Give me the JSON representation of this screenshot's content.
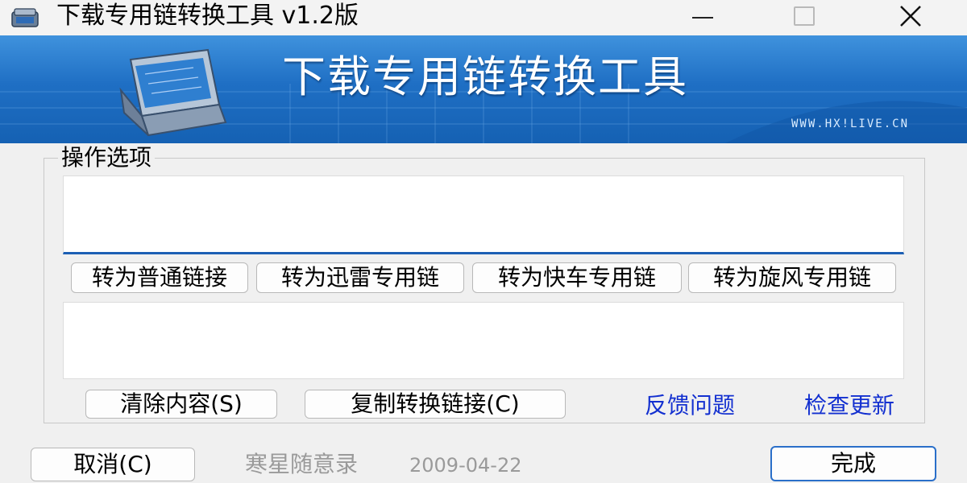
{
  "window": {
    "title": "下载专用链转换工具 v1.2版",
    "app_icon": "suitcase-icon",
    "controls": {
      "minimize_icon": "minimize-icon",
      "maximize_icon": "maximize-icon",
      "close_icon": "close-icon",
      "close_glyph": "✕"
    }
  },
  "banner": {
    "title": "下载专用链转换工具",
    "url": "WWW.HX!LIVE.CN",
    "icon": "suitcase-icon",
    "colors": {
      "top": "#3f92dd",
      "bottom": "#1561b3"
    }
  },
  "options": {
    "legend": "操作选项",
    "input": {
      "value": "",
      "placeholder": ""
    },
    "convert_buttons": [
      {
        "label": "转为普通链接"
      },
      {
        "label": "转为迅雷专用链"
      },
      {
        "label": "转为快车专用链"
      },
      {
        "label": "转为旋风专用链"
      }
    ],
    "output": {
      "value": "",
      "placeholder": ""
    },
    "clear_button": "清除内容(S)",
    "copy_button": "复制转换链接(C)",
    "links": {
      "feedback": "反馈问题",
      "update": "检查更新",
      "color": "#1330d0"
    }
  },
  "footer": {
    "cancel_button": "取消(C)",
    "author": "寒星随意录",
    "date": "2009-04-22",
    "done_button": "完成",
    "accent": "#2a6fc9"
  }
}
